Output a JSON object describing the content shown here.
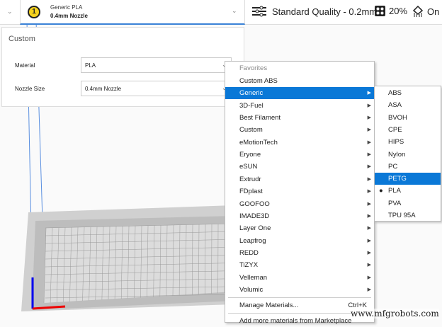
{
  "topbar": {
    "material_line1": "Generic PLA",
    "material_line2": "0.4mm Nozzle",
    "extruder_number": "1",
    "quality": "Standard Quality - 0.2mm",
    "infill": "20%",
    "support": "On"
  },
  "panel": {
    "title": "Custom",
    "material_label": "Material",
    "material_value": "PLA",
    "nozzle_label": "Nozzle Size",
    "nozzle_value": "0.4mm Nozzle"
  },
  "menu": {
    "header": "Favorites",
    "items": [
      "Custom ABS",
      "Generic",
      "3D-Fuel",
      "Best Filament",
      "Custom",
      "eMotionTech",
      "Eryone",
      "eSUN",
      "Extrudr",
      "FDplast",
      "GOOFOO",
      "IMADE3D",
      "Layer One",
      "Leapfrog",
      "REDD",
      "TiZYX",
      "Velleman",
      "Volumic"
    ],
    "highlighted": "Generic",
    "manage": "Manage Materials...",
    "manage_shortcut": "Ctrl+K",
    "marketplace": "Add more materials from Marketplace"
  },
  "submenu": {
    "items": [
      "ABS",
      "ASA",
      "BVOH",
      "CPE",
      "HIPS",
      "Nylon",
      "PC",
      "PETG",
      "PLA",
      "PVA",
      "TPU 95A"
    ],
    "highlighted": "PETG",
    "checked": "PLA"
  },
  "watermark": "www.mfgrobots.com",
  "colors": {
    "accent": "#0a78d7",
    "badge": "#f5d21c"
  }
}
